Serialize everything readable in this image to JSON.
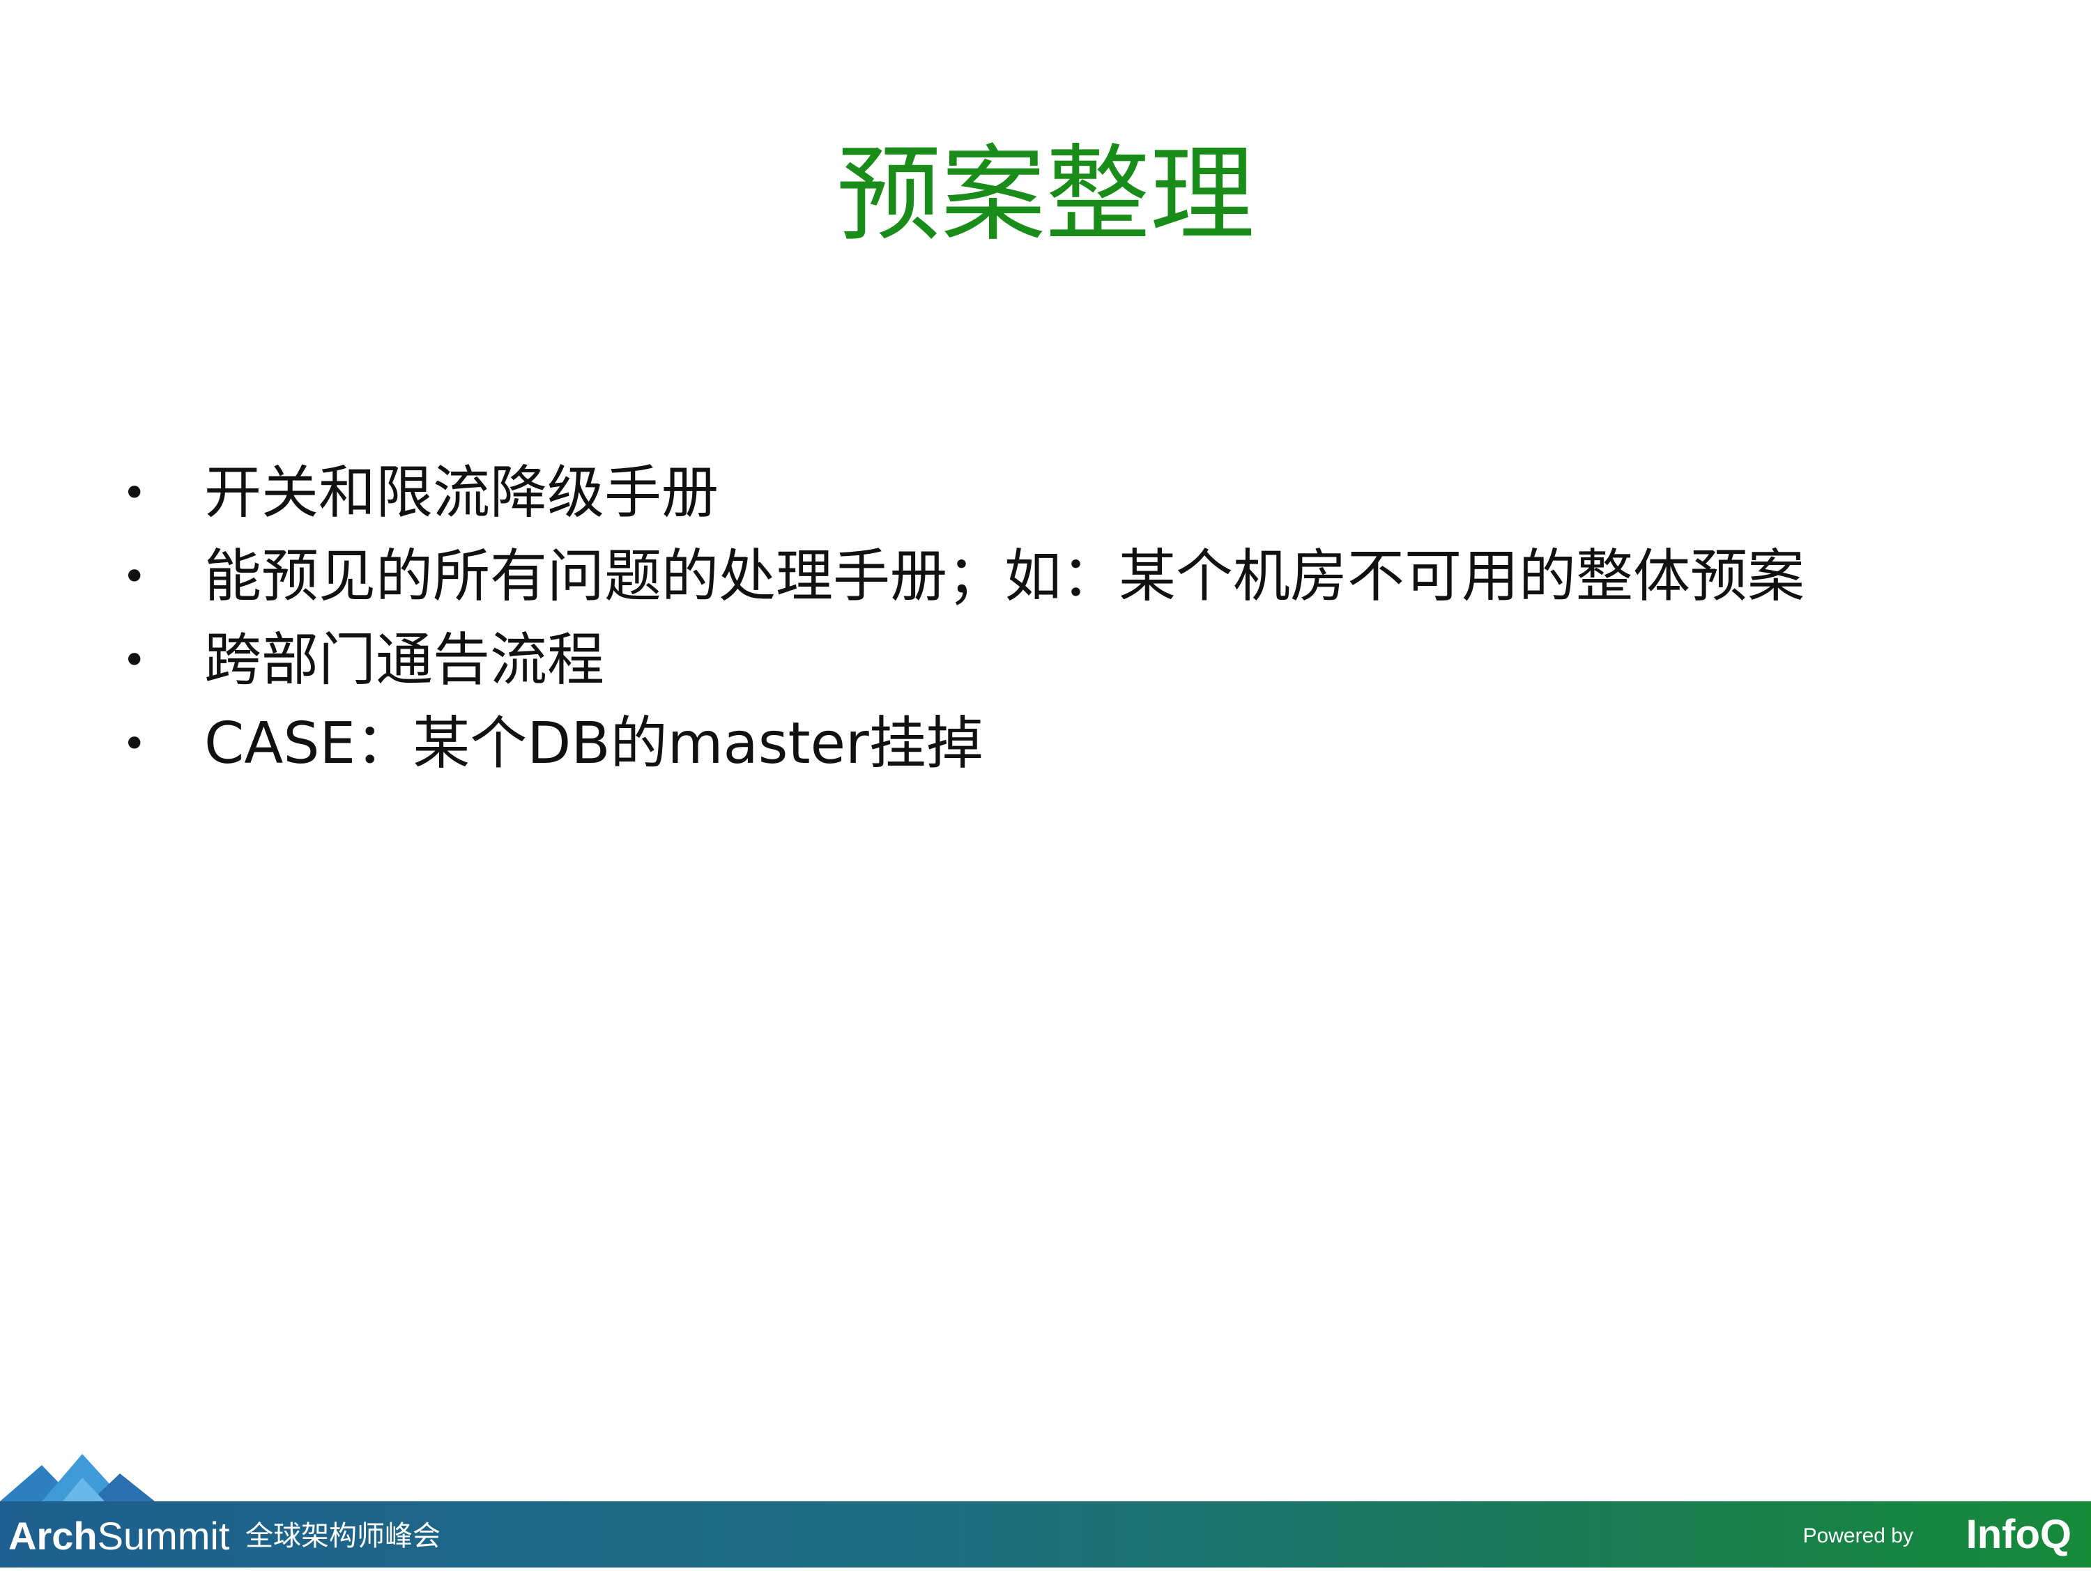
{
  "slide": {
    "title": "预案整理",
    "bullets": [
      "开关和限流降级手册",
      "能预见的所有问题的处理手册；如：某个机房不可用的整体预案",
      "跨部门通告流程",
      "CASE：某个DB的master挂掉"
    ],
    "bullet_symbol": "•"
  },
  "footer": {
    "brand_bold": "Arch",
    "brand_rest": "Summit",
    "subtitle": "全球架构师峰会",
    "powered_by": "Powered by",
    "partner": "InfoQ"
  },
  "colors": {
    "title": "#1a8c1a",
    "body_text": "#111111",
    "footer_left": "#1e5f8f",
    "footer_right": "#178a3a"
  },
  "icons": {
    "logo_mark": "mountain-peaks-icon"
  }
}
